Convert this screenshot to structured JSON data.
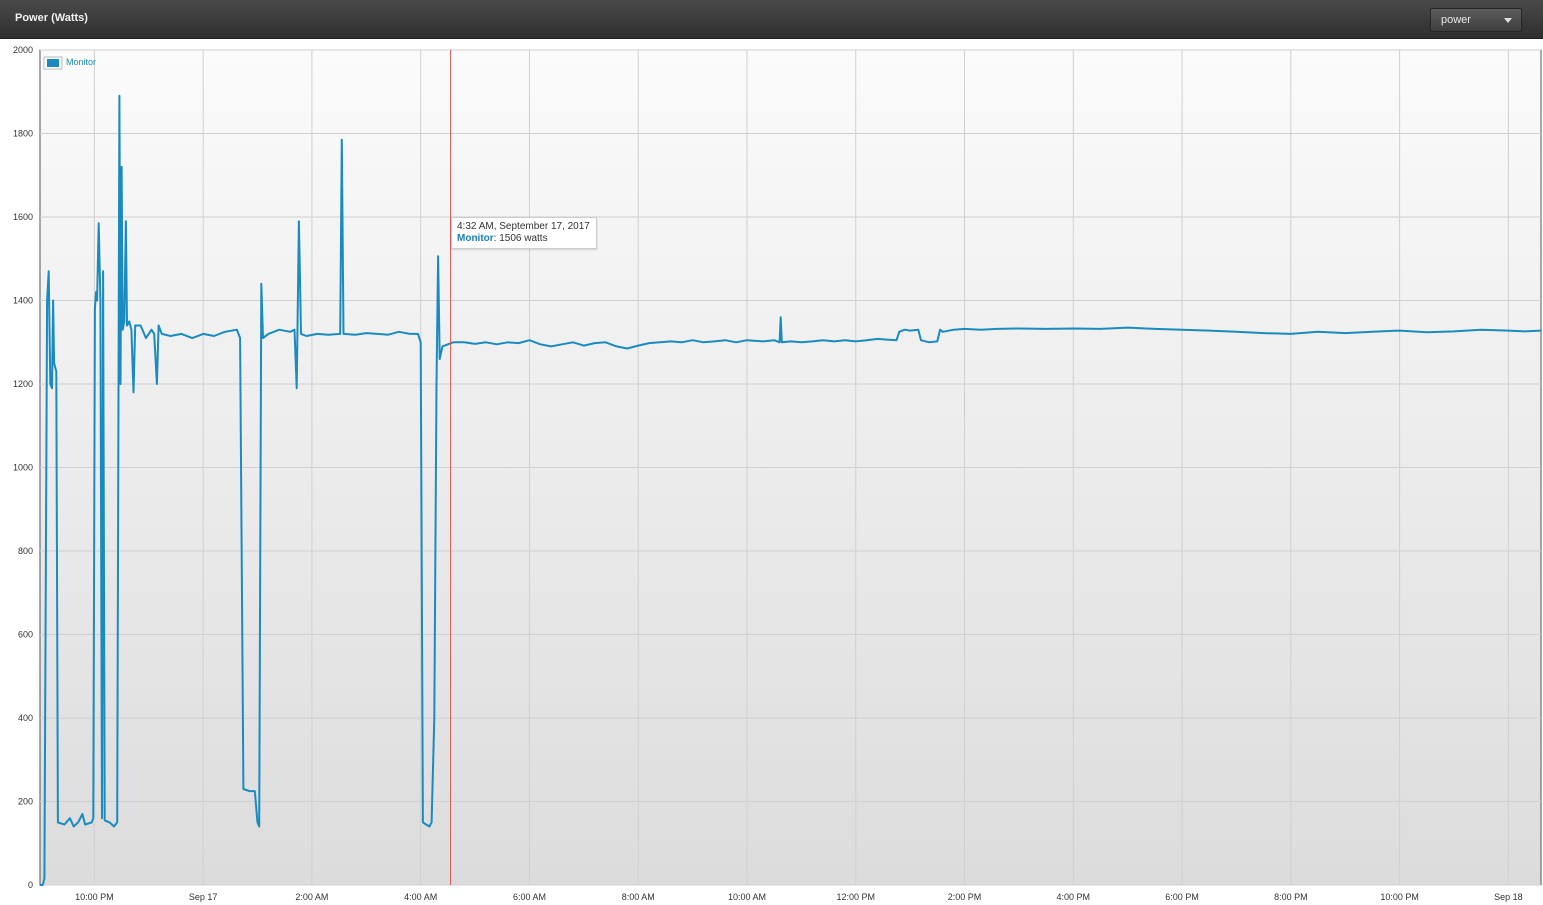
{
  "panel": {
    "title": "Power (Watts)",
    "metric_select": {
      "value": "power"
    }
  },
  "tooltip": {
    "time": "4:32 AM, September 17, 2017",
    "series": "Monitor",
    "value_text": ": 1506 watts"
  },
  "colors": {
    "series": "#1a8bbf",
    "cursor": "#d9534f",
    "grid": "#d0d0d0"
  },
  "chart_data": {
    "type": "line",
    "xlabel": "",
    "ylabel": "",
    "ylim": [
      0,
      2000
    ],
    "y_ticks": [
      "0",
      "200",
      "400",
      "600",
      "800",
      "1000",
      "1200",
      "1400",
      "1600",
      "1800",
      "2000"
    ],
    "x_range": [
      21.0,
      48.6
    ],
    "x_ticks": [
      {
        "label": "10:00 PM",
        "x": 22
      },
      {
        "label": "Sep 17",
        "x": 24
      },
      {
        "label": "2:00 AM",
        "x": 26
      },
      {
        "label": "4:00 AM",
        "x": 28
      },
      {
        "label": "6:00 AM",
        "x": 30
      },
      {
        "label": "8:00 AM",
        "x": 32
      },
      {
        "label": "10:00 AM",
        "x": 34
      },
      {
        "label": "12:00 PM",
        "x": 36
      },
      {
        "label": "2:00 PM",
        "x": 38
      },
      {
        "label": "4:00 PM",
        "x": 40
      },
      {
        "label": "6:00 PM",
        "x": 42
      },
      {
        "label": "8:00 PM",
        "x": 44
      },
      {
        "label": "10:00 PM",
        "x": 46
      },
      {
        "label": "Sep 18",
        "x": 48
      }
    ],
    "grid": true,
    "legend": {
      "position": "top-left"
    },
    "cursor_x": 28.55,
    "series": [
      {
        "name": "Monitor",
        "points": [
          [
            21.0,
            0
          ],
          [
            21.05,
            0
          ],
          [
            21.08,
            15
          ],
          [
            21.13,
            1400
          ],
          [
            21.16,
            1470
          ],
          [
            21.19,
            1200
          ],
          [
            21.22,
            1190
          ],
          [
            21.24,
            1400
          ],
          [
            21.26,
            1250
          ],
          [
            21.3,
            1230
          ],
          [
            21.33,
            150
          ],
          [
            21.45,
            145
          ],
          [
            21.55,
            160
          ],
          [
            21.62,
            140
          ],
          [
            21.7,
            150
          ],
          [
            21.78,
            170
          ],
          [
            21.83,
            145
          ],
          [
            21.95,
            150
          ],
          [
            21.98,
            160
          ],
          [
            22.01,
            1380
          ],
          [
            22.03,
            1420
          ],
          [
            22.05,
            1400
          ],
          [
            22.08,
            1585
          ],
          [
            22.11,
            1400
          ],
          [
            22.14,
            160
          ],
          [
            22.16,
            1470
          ],
          [
            22.19,
            155
          ],
          [
            22.28,
            150
          ],
          [
            22.36,
            140
          ],
          [
            22.42,
            150
          ],
          [
            22.46,
            1890
          ],
          [
            22.48,
            1200
          ],
          [
            22.5,
            1720
          ],
          [
            22.52,
            1330
          ],
          [
            22.55,
            1350
          ],
          [
            22.58,
            1590
          ],
          [
            22.6,
            1340
          ],
          [
            22.64,
            1350
          ],
          [
            22.68,
            1330
          ],
          [
            22.72,
            1180
          ],
          [
            22.75,
            1340
          ],
          [
            22.85,
            1340
          ],
          [
            22.95,
            1310
          ],
          [
            23.05,
            1330
          ],
          [
            23.1,
            1320
          ],
          [
            23.15,
            1200
          ],
          [
            23.18,
            1340
          ],
          [
            23.24,
            1320
          ],
          [
            23.4,
            1315
          ],
          [
            23.6,
            1320
          ],
          [
            23.8,
            1310
          ],
          [
            24.0,
            1320
          ],
          [
            24.2,
            1315
          ],
          [
            24.4,
            1325
          ],
          [
            24.62,
            1330
          ],
          [
            24.68,
            1310
          ],
          [
            24.74,
            230
          ],
          [
            24.85,
            225
          ],
          [
            24.95,
            225
          ],
          [
            25.0,
            150
          ],
          [
            25.03,
            140
          ],
          [
            25.07,
            1440
          ],
          [
            25.1,
            1310
          ],
          [
            25.2,
            1320
          ],
          [
            25.4,
            1330
          ],
          [
            25.6,
            1325
          ],
          [
            25.68,
            1330
          ],
          [
            25.72,
            1190
          ],
          [
            25.76,
            1590
          ],
          [
            25.8,
            1320
          ],
          [
            25.9,
            1315
          ],
          [
            26.1,
            1320
          ],
          [
            26.3,
            1318
          ],
          [
            26.52,
            1320
          ],
          [
            26.55,
            1785
          ],
          [
            26.58,
            1320
          ],
          [
            26.8,
            1318
          ],
          [
            27.0,
            1322
          ],
          [
            27.2,
            1320
          ],
          [
            27.4,
            1318
          ],
          [
            27.6,
            1325
          ],
          [
            27.8,
            1320
          ],
          [
            27.95,
            1320
          ],
          [
            28.0,
            1300
          ],
          [
            28.04,
            150
          ],
          [
            28.1,
            145
          ],
          [
            28.16,
            140
          ],
          [
            28.2,
            150
          ],
          [
            28.25,
            400
          ],
          [
            28.29,
            1200
          ],
          [
            28.32,
            1506
          ],
          [
            28.35,
            1260
          ],
          [
            28.4,
            1290
          ],
          [
            28.6,
            1300
          ],
          [
            28.8,
            1300
          ],
          [
            29.0,
            1296
          ],
          [
            29.2,
            1300
          ],
          [
            29.4,
            1295
          ],
          [
            29.6,
            1300
          ],
          [
            29.8,
            1298
          ],
          [
            30.0,
            1305
          ],
          [
            30.2,
            1295
          ],
          [
            30.4,
            1290
          ],
          [
            30.6,
            1295
          ],
          [
            30.8,
            1300
          ],
          [
            31.0,
            1292
          ],
          [
            31.2,
            1298
          ],
          [
            31.4,
            1300
          ],
          [
            31.6,
            1290
          ],
          [
            31.8,
            1285
          ],
          [
            32.0,
            1292
          ],
          [
            32.2,
            1298
          ],
          [
            32.4,
            1300
          ],
          [
            32.6,
            1302
          ],
          [
            32.8,
            1300
          ],
          [
            33.0,
            1305
          ],
          [
            33.2,
            1300
          ],
          [
            33.4,
            1302
          ],
          [
            33.6,
            1305
          ],
          [
            33.8,
            1300
          ],
          [
            34.0,
            1305
          ],
          [
            34.3,
            1302
          ],
          [
            34.5,
            1305
          ],
          [
            34.6,
            1300
          ],
          [
            34.62,
            1360
          ],
          [
            34.64,
            1300
          ],
          [
            34.8,
            1302
          ],
          [
            35.0,
            1300
          ],
          [
            35.2,
            1302
          ],
          [
            35.4,
            1305
          ],
          [
            35.6,
            1302
          ],
          [
            35.8,
            1305
          ],
          [
            36.0,
            1302
          ],
          [
            36.2,
            1305
          ],
          [
            36.4,
            1308
          ],
          [
            36.6,
            1306
          ],
          [
            36.75,
            1305
          ],
          [
            36.8,
            1325
          ],
          [
            36.9,
            1330
          ],
          [
            37.0,
            1328
          ],
          [
            37.15,
            1330
          ],
          [
            37.2,
            1305
          ],
          [
            37.35,
            1300
          ],
          [
            37.5,
            1302
          ],
          [
            37.55,
            1330
          ],
          [
            37.6,
            1325
          ],
          [
            37.8,
            1330
          ],
          [
            38.0,
            1332
          ],
          [
            38.3,
            1330
          ],
          [
            38.6,
            1332
          ],
          [
            39.0,
            1333
          ],
          [
            39.5,
            1332
          ],
          [
            40.0,
            1333
          ],
          [
            40.5,
            1332
          ],
          [
            41.0,
            1335
          ],
          [
            41.5,
            1332
          ],
          [
            42.0,
            1330
          ],
          [
            42.5,
            1328
          ],
          [
            43.0,
            1325
          ],
          [
            43.5,
            1322
          ],
          [
            44.0,
            1320
          ],
          [
            44.5,
            1325
          ],
          [
            45.0,
            1322
          ],
          [
            45.5,
            1325
          ],
          [
            46.0,
            1328
          ],
          [
            46.5,
            1324
          ],
          [
            47.0,
            1326
          ],
          [
            47.5,
            1330
          ],
          [
            48.0,
            1328
          ],
          [
            48.3,
            1326
          ],
          [
            48.6,
            1328
          ]
        ]
      }
    ]
  }
}
